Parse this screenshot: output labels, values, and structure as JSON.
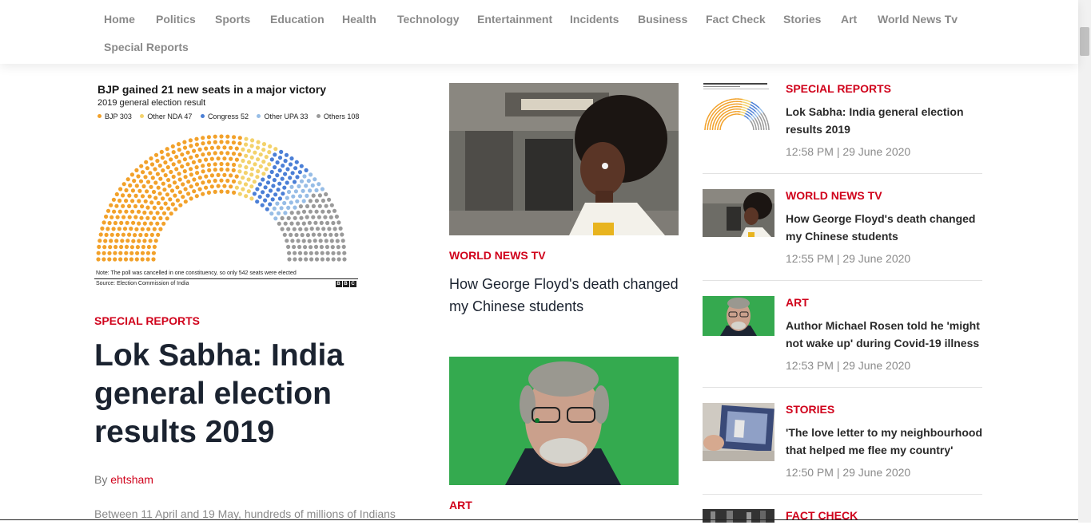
{
  "nav": {
    "items": [
      "Home",
      "Politics",
      "Sports",
      "Education",
      "Health",
      "Technology",
      "Entertainment",
      "Incidents",
      "Business",
      "Fact Check",
      "Stories",
      "Art",
      "World News Tv",
      "Special Reports"
    ]
  },
  "featured": {
    "category": "SPECIAL REPORTS",
    "headline": "Lok Sabha: India general election results 2019",
    "by_label": "By",
    "author": "ehtsham",
    "excerpt": "Between 11 April and 19 May, hundreds of millions of Indians",
    "chart": {
      "title": "BJP gained 21 new seats in a major victory",
      "subtitle": "2019 general election result",
      "note": "Note: The poll was cancelled in one constituency, so only 542 seats were elected",
      "source": "Source: Election Commission of India",
      "logo": [
        "B",
        "B",
        "C"
      ]
    }
  },
  "chart_data": {
    "type": "parliament",
    "series": [
      {
        "name": "BJP",
        "value": 303,
        "color": "#f2a12a"
      },
      {
        "name": "Other NDA",
        "value": 47,
        "color": "#f3d26b"
      },
      {
        "name": "Congress",
        "value": 52,
        "color": "#4b7fd6"
      },
      {
        "name": "Other UPA",
        "value": 33,
        "color": "#97bde6"
      },
      {
        "name": "Others",
        "value": 108,
        "color": "#9a9a9a"
      }
    ],
    "legend_labels": [
      "BJP 303",
      "Other NDA 47",
      "Congress 52",
      "Other UPA 33",
      "Others 108"
    ],
    "total": 543
  },
  "middle": [
    {
      "category": "WORLD NEWS TV",
      "headline": "How George Floyd's death changed my Chinese students"
    },
    {
      "category": "ART"
    }
  ],
  "sidebar": [
    {
      "category": "SPECIAL REPORTS",
      "title": "Lok Sabha: India general election results 2019",
      "time": "12:58 PM | 29 June 2020",
      "thumb": "chart"
    },
    {
      "category": "WORLD NEWS TV",
      "title": "How George Floyd's death changed my Chinese students",
      "time": "12:55 PM | 29 June 2020",
      "thumb": "woman"
    },
    {
      "category": "ART",
      "title": "Author Michael Rosen told he 'might not wake up' during Covid-19 illness",
      "time": "12:53 PM | 29 June 2020",
      "thumb": "man"
    },
    {
      "category": "STORIES",
      "title": "'The love letter to my neighbourhood that helped me flee my country'",
      "time": "12:50 PM | 29 June 2020",
      "thumb": "photo"
    },
    {
      "category": "FACT CHECK"
    }
  ],
  "colors": {
    "accent": "#d0021b",
    "headline": "#1b2330",
    "muted": "#8a8a8a"
  }
}
